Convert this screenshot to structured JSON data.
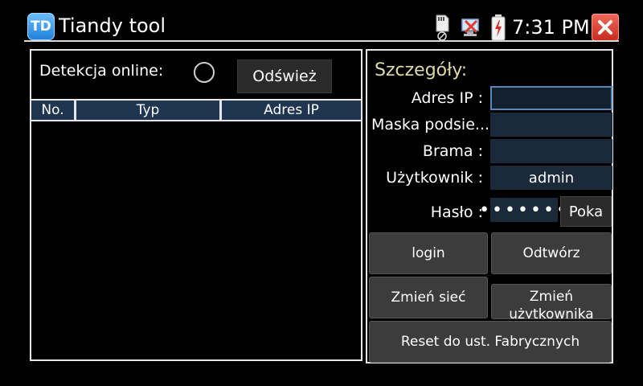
{
  "titlebar": {
    "logo_text": "TD",
    "title": "Tiandy tool",
    "time": "7:31 PM",
    "icons": [
      "sd-card-icon",
      "network-disconnected-icon",
      "battery-charging-icon",
      "close-icon"
    ],
    "colors": {
      "close": "#d93a2b",
      "logo": "#3a9cf0"
    }
  },
  "detection": {
    "label": "Detekcja online:",
    "refresh_label": "Odśwież",
    "columns": [
      "No.",
      "Typ",
      "Adres IP"
    ],
    "rows": []
  },
  "details": {
    "title": "Szczegóły:",
    "ip_label": "Adres IP :",
    "ip_value": "",
    "mask_label": "Maska podsie...",
    "mask_value": "",
    "gateway_label": "Brama :",
    "gateway_value": "",
    "user_label": "Użytkownik :",
    "user_value": "admin",
    "password_label": "Hasło :",
    "password_value": "•••••••",
    "show_label": "Poka"
  },
  "actions": {
    "login": "login",
    "restore": "Odtwórz",
    "change_network": "Zmień sieć",
    "change_user": "Zmień użytkownika",
    "factory_reset": "Reset do ust. Fabrycznych"
  },
  "colors": {
    "header_bg": "#1f3550",
    "input_bg": "#1b2a3a",
    "title_accent": "#ddd9a8"
  }
}
